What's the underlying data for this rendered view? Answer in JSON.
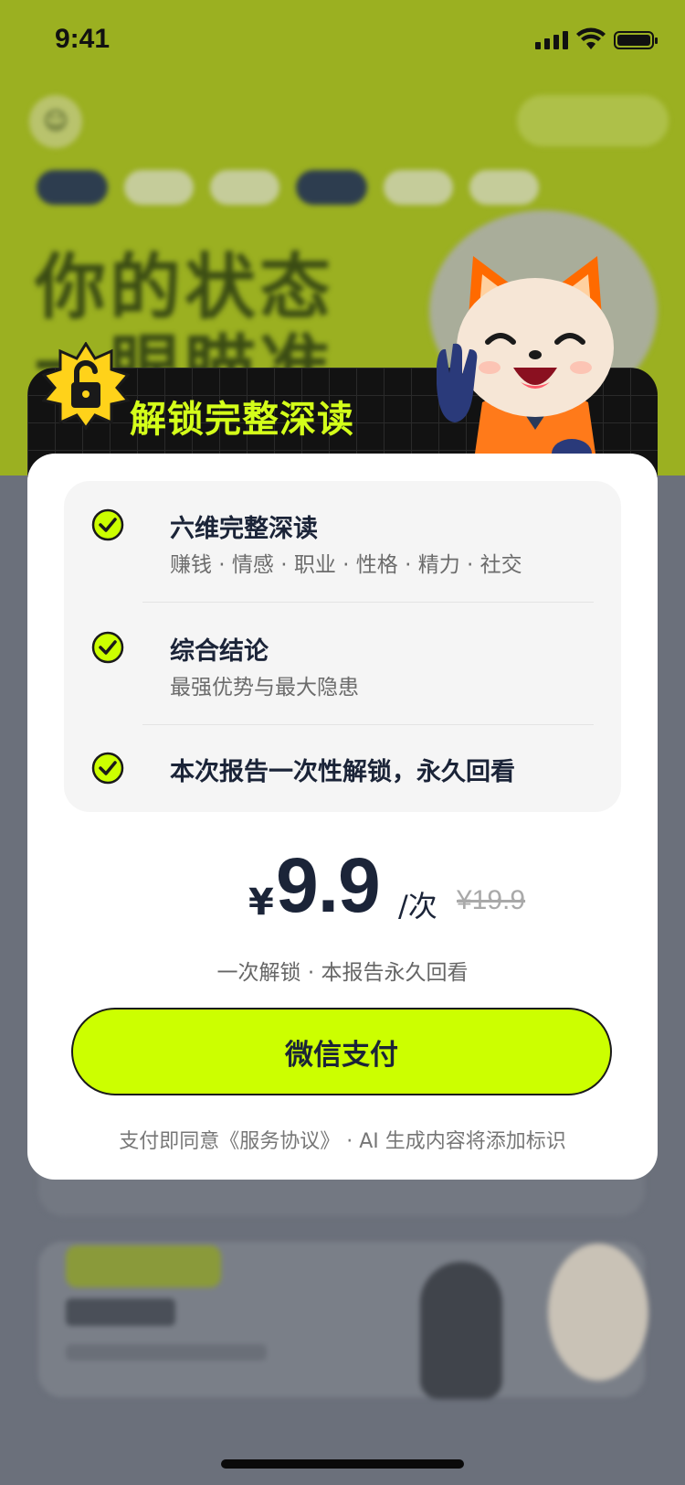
{
  "status_bar": {
    "time": "9:41"
  },
  "background": {
    "headline_line1": "你的状态",
    "headline_line2": "一眼瞄准"
  },
  "modal": {
    "header_title": "解锁完整深读",
    "features": [
      {
        "title": "六维完整深读",
        "subtitle": "赚钱 · 情感 · 职业 · 性格 · 精力 · 社交"
      },
      {
        "title": "综合结论",
        "subtitle": "最强优势与最大隐患"
      },
      {
        "title": "本次报告一次性解锁，永久回看",
        "subtitle": ""
      }
    ],
    "price": {
      "currency": "¥",
      "amount": "9.9",
      "unit": "/次",
      "original": "¥19.9",
      "note": "一次解锁 · 本报告永久回看"
    },
    "pay_button_label": "微信支付",
    "agreement": "支付即同意《服务协议》 · AI 生成内容将添加标识"
  },
  "colors": {
    "accent": "#ccff00",
    "header_bg": "#121212",
    "text_dark": "#1b2438",
    "bg_green": "#9bb021",
    "overlay_gray": "#6b707b"
  }
}
